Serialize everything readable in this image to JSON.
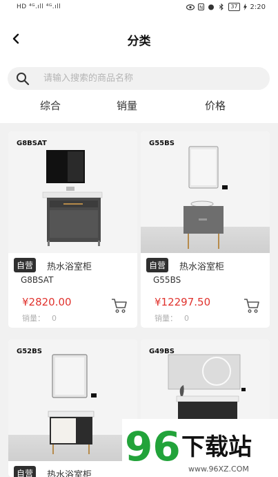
{
  "status_bar": {
    "left_text": "HD ⁴ᴳ.ıll ⁴ᴳ.ıll",
    "battery": "37",
    "time": "2:20"
  },
  "header": {
    "title": "分类"
  },
  "search": {
    "placeholder": "请输入搜索的商品名称",
    "value": ""
  },
  "sort_tabs": [
    "综合",
    "销量",
    "价格"
  ],
  "products": [
    {
      "model_tag": "G8BSAT",
      "badge": "自营",
      "name": "热水浴室柜",
      "model": "G8BSAT",
      "price": "¥2820.00",
      "sales_label": "销量：",
      "sales_value": "0"
    },
    {
      "model_tag": "G55BS",
      "badge": "自营",
      "name": "热水浴室柜",
      "model": "G55BS",
      "price": "¥12297.50",
      "sales_label": "销量：",
      "sales_value": "0"
    },
    {
      "model_tag": "G52BS",
      "badge": "自营",
      "name": "热水浴室柜"
    },
    {
      "model_tag": "G49BS"
    }
  ],
  "watermark": {
    "logo_text": "96下载站",
    "url": "www.96XZ.COM"
  },
  "colors": {
    "price": "#e0322d",
    "badge_bg": "#2f2f2f",
    "watermark_green": "#22a33a"
  }
}
